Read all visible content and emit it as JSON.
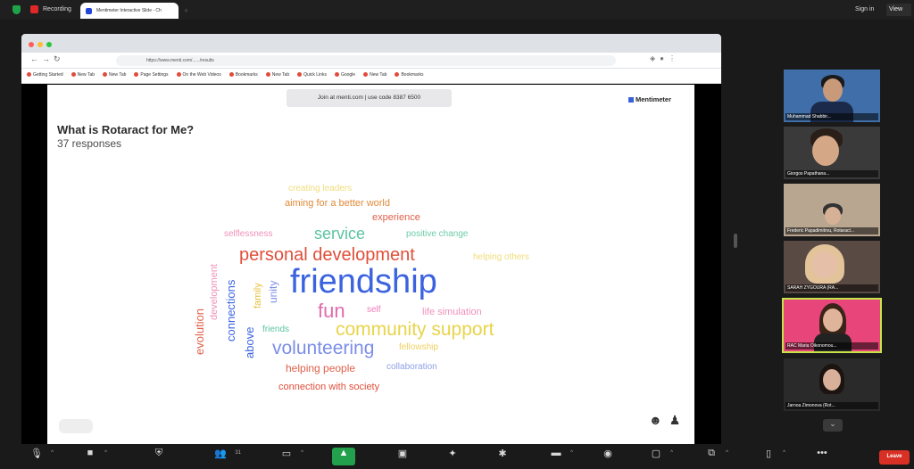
{
  "zoom": {
    "recording_label": "Recording",
    "signin_label": "Sign in",
    "view_label": "View",
    "leave_label": "Leave",
    "participants_count": "31"
  },
  "browser": {
    "tab_title": "Mentimeter Interactive Slide - Ch",
    "new_tab": "+",
    "url": "https://www.menti.com/....../results",
    "bookmarks": [
      "Getting Started",
      "New Tab",
      "New Tab",
      "Page Settings",
      "On the Web Videos",
      "Bookmarks",
      "New Tab",
      "Quick Links",
      "Google",
      "New Tab",
      "Bookmarks"
    ]
  },
  "slide": {
    "join_text": "Join at menti.com | use code 8387 6500",
    "brand": "Mentimeter",
    "question": "What is Rotaract for Me?",
    "responses": "37 responses"
  },
  "word_cloud": {
    "words": [
      {
        "text": "friendship",
        "color": "#3b63e0"
      },
      {
        "text": "personal development",
        "color": "#e04f3a"
      },
      {
        "text": "fun",
        "color": "#e06bb0"
      },
      {
        "text": "community support",
        "color": "#e8d44a"
      },
      {
        "text": "volunteering",
        "color": "#7b8ee8"
      },
      {
        "text": "service",
        "color": "#5cc4a0"
      },
      {
        "text": "creating leaders",
        "color": "#f0dd7a"
      },
      {
        "text": "aiming for a better world",
        "color": "#e08a3a"
      },
      {
        "text": "experience",
        "color": "#e0604a"
      },
      {
        "text": "selflessness",
        "color": "#f091b8"
      },
      {
        "text": "positive change",
        "color": "#6ccca8"
      },
      {
        "text": "helping others",
        "color": "#f0dd7a"
      },
      {
        "text": "self",
        "color": "#f07ab8"
      },
      {
        "text": "life simulation",
        "color": "#f091b8"
      },
      {
        "text": "friends",
        "color": "#5cc4a0"
      },
      {
        "text": "fellowship",
        "color": "#f0d060"
      },
      {
        "text": "helping people",
        "color": "#e0604a"
      },
      {
        "text": "collaboration",
        "color": "#8ea0e8"
      },
      {
        "text": "connection with society",
        "color": "#e04f3a"
      },
      {
        "text": "evolution",
        "color": "#e0604a"
      },
      {
        "text": "development",
        "color": "#f091b8"
      },
      {
        "text": "connections",
        "color": "#3b63e0"
      },
      {
        "text": "above",
        "color": "#3b63e0"
      },
      {
        "text": "family",
        "color": "#e8c040"
      },
      {
        "text": "unity",
        "color": "#7b8ee8"
      }
    ]
  },
  "participants": [
    {
      "name": "Muhammad Shabbir..."
    },
    {
      "name": "Giorgos Papathana..."
    },
    {
      "name": "Frederic Papadimitrou, Rotaract..."
    },
    {
      "name": "SARAH ZYGOURA (RA..."
    },
    {
      "name": "RAC Maria Oikonomou..."
    },
    {
      "name": "Jarnoa Zimonova (Rot..."
    }
  ],
  "toolbar": {
    "items": [
      "mic-icon",
      "video-icon",
      "security-icon",
      "participants-icon",
      "chat-icon",
      "share-icon",
      "record-icon",
      "reactions-icon",
      "apps-icon",
      "whiteboard-icon",
      "notes-icon",
      "captions-icon",
      "breakout-icon",
      "more-icon"
    ]
  }
}
